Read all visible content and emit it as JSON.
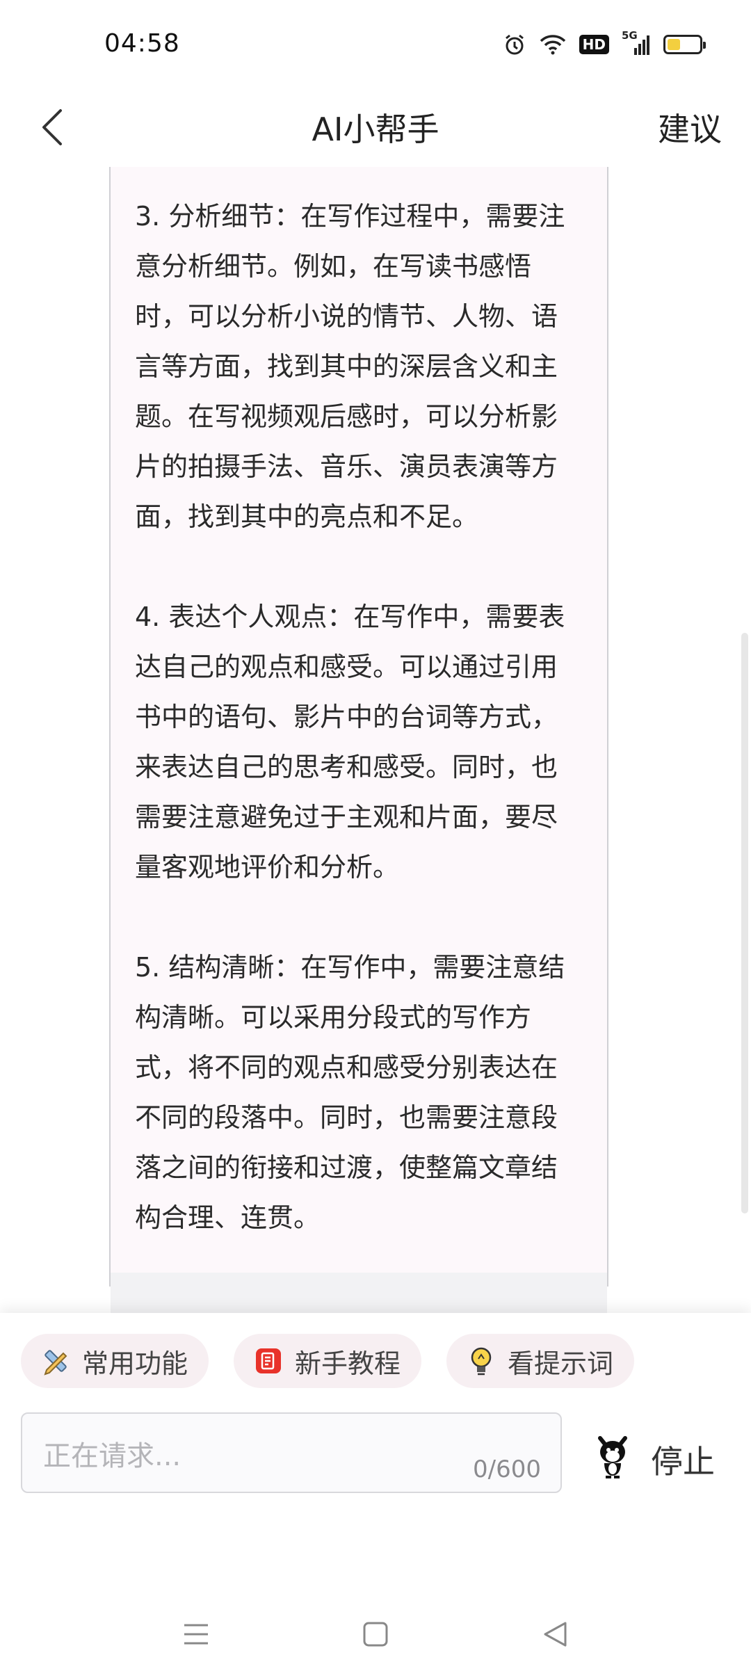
{
  "status_bar": {
    "time": "04:58",
    "hd_label": "HD",
    "network_label": "5G"
  },
  "header": {
    "title": "AI小帮手",
    "suggest_label": "建议"
  },
  "message": {
    "text": "3. 分析细节：在写作过程中，需要注意分析细节。例如，在写读书感悟时，可以分析小说的情节、人物、语言等方面，找到其中的深层含义和主题。在写视频观后感时，可以分析影片的拍摄手法、音乐、演员表演等方面，找到其中的亮点和不足。\n\n4. 表达个人观点：在写作中，需要表达自己的观点和感受。可以通过引用书中的语句、影片中的台词等方式，来表达自己的思考和感受。同时，也需要注意避免过于主观和片面，要尽量客观地评价和分析。\n\n5. 结构清晰：在写作中，需要注意结构清晰。可以采用分段式的写作方式，将不同的观点和感受分别表达在不同的段落中。同时，也需要注意段落之间的衔接和过渡，使整篇文章结构合理、连贯。"
  },
  "quick_actions": [
    {
      "label": "常用功能",
      "icon": "pencil-ruler-icon"
    },
    {
      "label": "新手教程",
      "icon": "tutorial-book-icon"
    },
    {
      "label": "看提示词",
      "icon": "lightbulb-icon"
    }
  ],
  "input": {
    "placeholder": "正在请求...",
    "counter": "0/600"
  },
  "stop_label": "停止",
  "colors": {
    "bubble_bg": "#fdf8fb",
    "chip_bg": "#f7eff2",
    "tutorial_icon": "#e8322a",
    "battery": "#f3cf3f"
  }
}
